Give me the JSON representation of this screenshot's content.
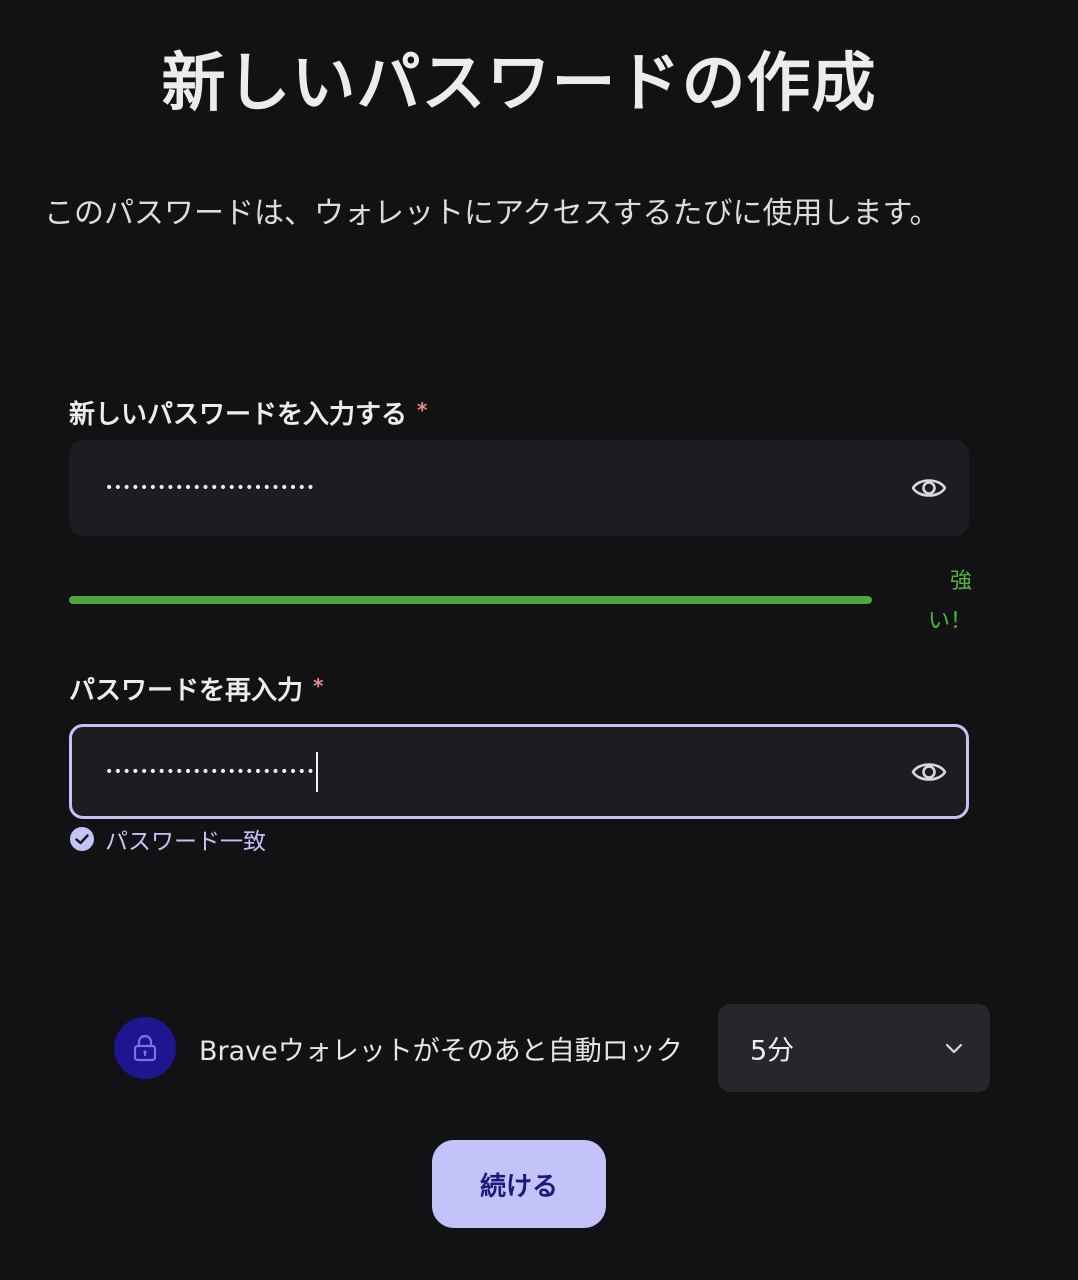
{
  "header": {
    "title": "新しいパスワードの作成",
    "subtitle": "このパスワードは、ウォレットにアクセスするたびに使用します。"
  },
  "new_password": {
    "label": "新しいパスワードを入力する",
    "required_mark": "*",
    "value": "••••••••••••••••••••••••",
    "visibility_icon": "eye-icon"
  },
  "strength": {
    "label": "強い！",
    "level": 1.0,
    "color": "#4fa63a"
  },
  "confirm_password": {
    "label": "パスワードを再入力",
    "required_mark": "*",
    "value": "••••••••••••••••••••••••",
    "visibility_icon": "eye-icon",
    "focused": true,
    "focus_color": "#c3c3f5"
  },
  "match": {
    "icon": "check-circle-icon",
    "text": "パスワード一致"
  },
  "autolock": {
    "icon": "lock-icon",
    "text": "Braveウォレットがそのあと自動ロック",
    "selected": "5分",
    "dropdown_icon": "chevron-down-icon"
  },
  "actions": {
    "continue_label": "続ける",
    "accent": "#c3c3f9"
  }
}
